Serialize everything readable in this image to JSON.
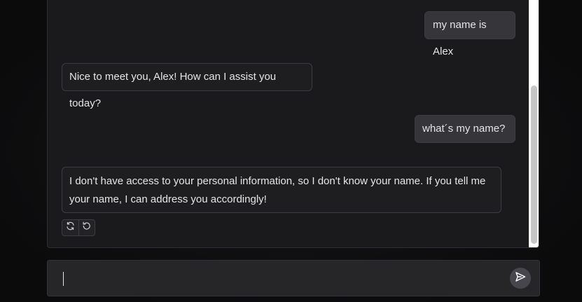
{
  "chat": {
    "messages": [
      {
        "role": "user",
        "text": "my name is Alex"
      },
      {
        "role": "assistant",
        "text": "Nice to meet you, Alex! How can I assist you today?"
      },
      {
        "role": "user",
        "text": "what´s my name?"
      },
      {
        "role": "assistant",
        "text": "I don't have access to your personal information, so I don't know your name. If you tell me your name, I can address you accordingly!"
      }
    ],
    "actions": [
      {
        "icon": "refresh-icon"
      },
      {
        "icon": "undo-icon"
      }
    ]
  },
  "composer": {
    "value": "",
    "placeholder": "",
    "send_icon": "send-icon"
  },
  "colors": {
    "background": "#0b0b0c",
    "panel": "#1a1a1d",
    "user_bubble": "#35353a",
    "assistant_bubble": "#1e1e21",
    "border": "#3c3c42",
    "text": "#e6e6e8"
  }
}
